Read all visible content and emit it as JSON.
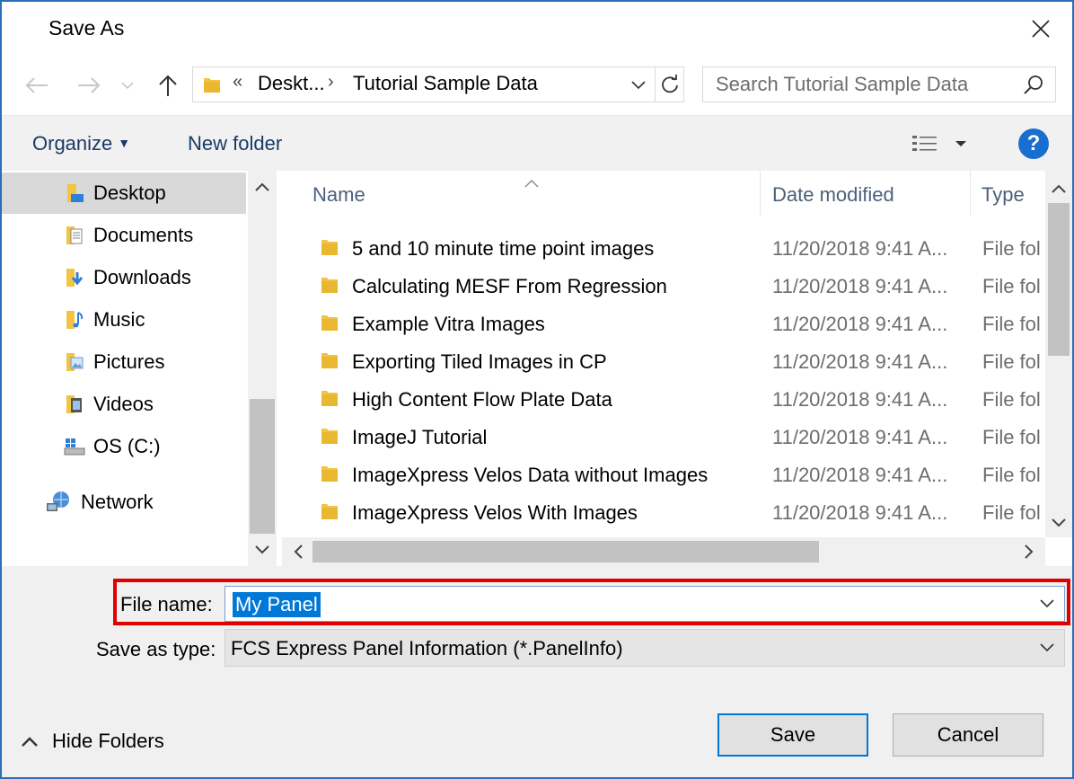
{
  "window": {
    "title": "Save As"
  },
  "address": {
    "overflow": "«",
    "segment1": "Deskt...",
    "separator": "›",
    "segment2": "Tutorial Sample Data"
  },
  "search": {
    "placeholder": "Search Tutorial Sample Data"
  },
  "toolbar": {
    "organize_label": "Organize",
    "new_folder_label": "New folder",
    "help_label": "?"
  },
  "navpane": {
    "items": [
      {
        "label": "Desktop",
        "icon": "desktop-folder-icon",
        "selected": true
      },
      {
        "label": "Documents",
        "icon": "documents-icon"
      },
      {
        "label": "Downloads",
        "icon": "downloads-icon"
      },
      {
        "label": "Music",
        "icon": "music-icon"
      },
      {
        "label": "Pictures",
        "icon": "pictures-icon"
      },
      {
        "label": "Videos",
        "icon": "videos-icon"
      },
      {
        "label": "OS (C:)",
        "icon": "drive-icon"
      }
    ],
    "network": {
      "label": "Network",
      "icon": "network-icon"
    }
  },
  "filelist": {
    "columns": {
      "name": "Name",
      "date": "Date modified",
      "type": "Type"
    },
    "rows": [
      {
        "name": "5 and 10 minute time point images",
        "date": "11/20/2018 9:41 A...",
        "type": "File fol"
      },
      {
        "name": "Calculating MESF From Regression",
        "date": "11/20/2018 9:41 A...",
        "type": "File fol"
      },
      {
        "name": "Example Vitra Images",
        "date": "11/20/2018 9:41 A...",
        "type": "File fol"
      },
      {
        "name": "Exporting Tiled Images in CP",
        "date": "11/20/2018 9:41 A...",
        "type": "File fol"
      },
      {
        "name": "High Content Flow Plate Data",
        "date": "11/20/2018 9:41 A...",
        "type": "File fol"
      },
      {
        "name": "ImageJ Tutorial",
        "date": "11/20/2018 9:41 A...",
        "type": "File fol"
      },
      {
        "name": "ImageXpress Velos Data without Images",
        "date": "11/20/2018 9:41 A...",
        "type": "File fol"
      },
      {
        "name": "ImageXpress Velos With Images",
        "date": "11/20/2018 9:41 A...",
        "type": "File fol"
      }
    ]
  },
  "form": {
    "file_name_label": "File name:",
    "file_name_value": "My Panel",
    "save_as_type_label": "Save as type:",
    "save_as_type_value": "FCS Express Panel Information (*.PanelInfo)"
  },
  "footer": {
    "hide_folders_label": "Hide Folders",
    "save_label": "Save",
    "cancel_label": "Cancel"
  },
  "colors": {
    "accent": "#0078d7",
    "highlight": "#e00000",
    "link": "#1a3b66",
    "folder": "#f3c443"
  }
}
